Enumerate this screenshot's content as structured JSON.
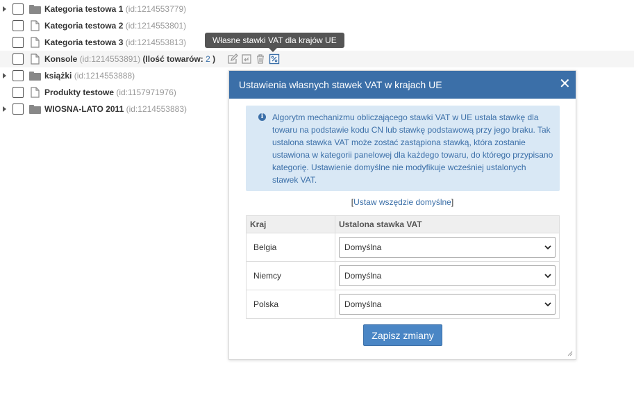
{
  "tree": {
    "items": [
      {
        "name": "Kategoria testowa 1",
        "id": "(id:1214553779)"
      },
      {
        "name": "Kategoria testowa 2",
        "id": "(id:1214553801)"
      },
      {
        "name": "Kategoria testowa 3",
        "id": "(id:1214553813)"
      },
      {
        "name": "Konsole",
        "id": "(id:1214553891)",
        "count_prefix": "(Ilość towarów:",
        "count": "2",
        "count_suffix": ")"
      },
      {
        "name": "książki",
        "id": "(id:1214553888)"
      },
      {
        "name": "Produkty testowe",
        "id": "(id:1157971976)"
      },
      {
        "name": "WIOSNA-LATO 2011",
        "id": "(id:1214553883)"
      }
    ]
  },
  "tooltip": {
    "text": "Własne stawki VAT dla krajów UE"
  },
  "dialog": {
    "title": "Ustawienia własnych stawek VAT w krajach UE",
    "close": "✕",
    "info": "Algorytm mechanizmu obliczającego stawki VAT w UE ustala stawkę dla towaru na podstawie kodu CN lub stawkę podstawową przy jego braku. Tak ustalona stawka VAT może zostać zastąpiona stawką, która zostanie ustawiona w kategorii panelowej dla każdego towaru, do którego przypisano kategorię. Ustawienie domyślne nie modyfikuje wcześniej ustalonych stawek VAT.",
    "default_link": {
      "open": "[",
      "label": "Ustaw wszędzie domyślne",
      "close": "]"
    },
    "table": {
      "headers": [
        "Kraj",
        "Ustalona stawka VAT"
      ],
      "rows": [
        {
          "country": "Belgia",
          "value": "Domyślna"
        },
        {
          "country": "Niemcy",
          "value": "Domyślna"
        },
        {
          "country": "Polska",
          "value": "Domyślna"
        }
      ]
    },
    "save_label": "Zapisz zmiany"
  },
  "colors": {
    "accent": "#3b6fa8",
    "info_bg": "#d9e8f5",
    "button": "#4a86c5",
    "tooltip_bg": "#555555"
  }
}
